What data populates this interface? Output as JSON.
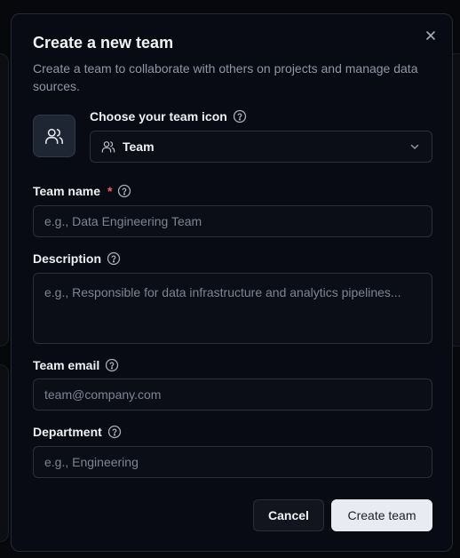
{
  "dialog": {
    "title": "Create a new team",
    "subtitle": "Create a team to collaborate with others on projects and manage data sources."
  },
  "team_icon": {
    "label": "Choose your team icon",
    "selected": "Team",
    "icon": "users-icon"
  },
  "fields": {
    "team_name": {
      "label": "Team name",
      "required_mark": "*",
      "placeholder": "e.g., Data Engineering Team",
      "value": ""
    },
    "description": {
      "label": "Description",
      "placeholder": "e.g., Responsible for data infrastructure and analytics pipelines...",
      "value": ""
    },
    "team_email": {
      "label": "Team email",
      "placeholder": "team@company.com",
      "value": ""
    },
    "department": {
      "label": "Department",
      "placeholder": "e.g., Engineering",
      "value": ""
    }
  },
  "actions": {
    "cancel_label": "Cancel",
    "create_label": "Create team"
  },
  "colors": {
    "modal_bg": "#090b14",
    "required": "#f25c69",
    "primary_button": "#e9ebf2"
  }
}
